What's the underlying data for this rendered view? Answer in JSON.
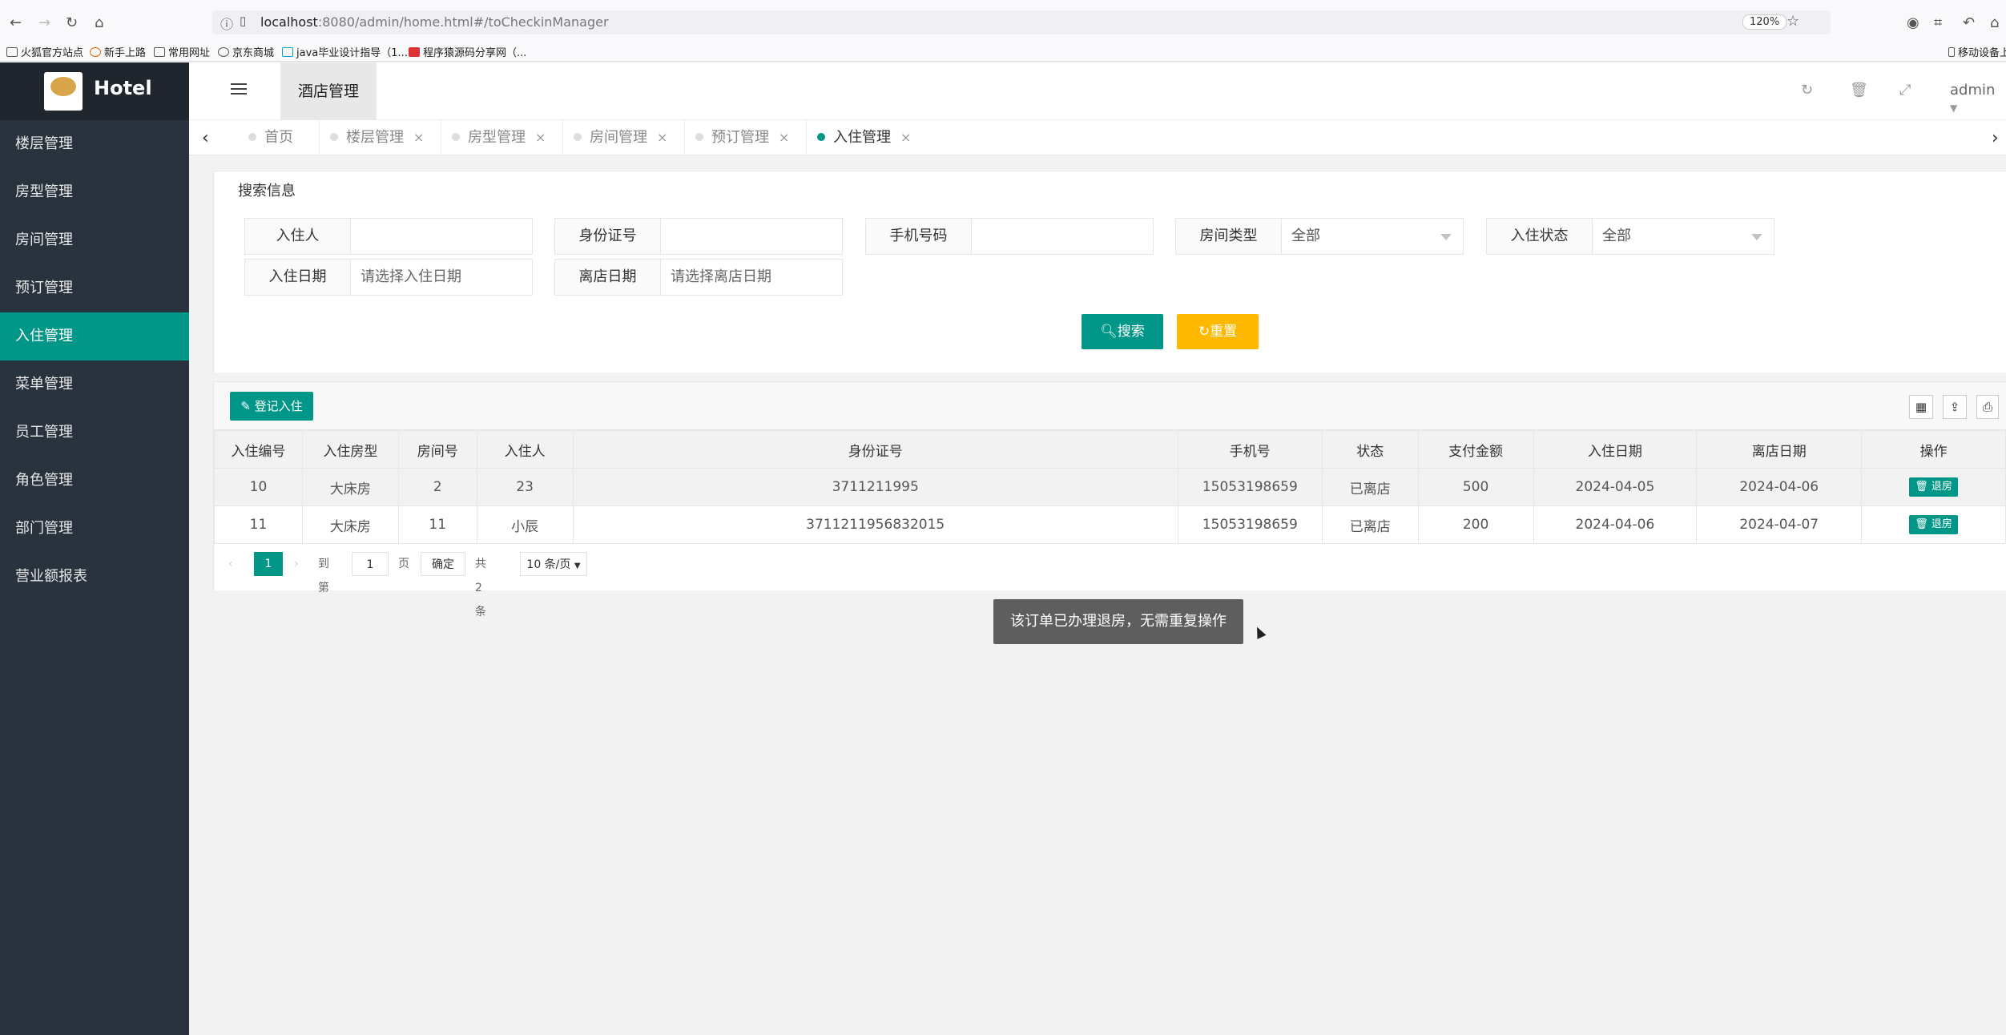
{
  "browser": {
    "url_host": "localhost",
    "url_path": ":8080/admin/home.html#/toCheckinManager",
    "zoom": "120%",
    "bookmarks": [
      "火狐官方站点",
      "新手上路",
      "常用网址",
      "京东商城",
      "java毕业设计指导（1...",
      "程序猿源码分享网（...",
      "移动设备上"
    ]
  },
  "sidebar": {
    "logo": "Hotel",
    "items": [
      "楼层管理",
      "房型管理",
      "房间管理",
      "预订管理",
      "入住管理",
      "菜单管理",
      "员工管理",
      "角色管理",
      "部门管理",
      "营业额报表"
    ],
    "active": "入住管理"
  },
  "header": {
    "tab": "酒店管理",
    "user": "admin"
  },
  "tabs": [
    "首页",
    "楼层管理",
    "房型管理",
    "房间管理",
    "预订管理",
    "入住管理"
  ],
  "search": {
    "legend": "搜索信息",
    "guest_label": "入住人",
    "idcard_label": "身份证号",
    "phone_label": "手机号码",
    "roomtype_label": "房间类型",
    "roomtype_value": "全部",
    "status_label": "入住状态",
    "status_value": "全部",
    "checkin_label": "入住日期",
    "checkin_placeholder": "请选择入住日期",
    "checkout_label": "离店日期",
    "checkout_placeholder": "请选择离店日期",
    "search_btn": "搜索",
    "reset_btn": "重置"
  },
  "toolbar": {
    "checkin_btn": "登记入住"
  },
  "table": {
    "headers": [
      "入住编号",
      "入住房型",
      "房间号",
      "入住人",
      "身份证号",
      "手机号",
      "状态",
      "支付金额",
      "入住日期",
      "离店日期",
      "操作"
    ],
    "rows": [
      [
        "10",
        "大床房",
        "2",
        "23",
        "3711211995",
        "15053198659",
        "已离店",
        "500",
        "2024-04-05",
        "2024-04-06",
        "退房"
      ],
      [
        "11",
        "大床房",
        "11",
        "小辰",
        "3711211956832015",
        "15053198659",
        "已离店",
        "200",
        "2024-04-06",
        "2024-04-07",
        "退房"
      ]
    ]
  },
  "pager": {
    "current": "1",
    "goto": "到第",
    "page_input": "1",
    "page_unit": "页",
    "confirm": "确定",
    "total": "共 2 条",
    "page_size": "10 条/页"
  },
  "toast": "该订单已办理退房，无需重复操作"
}
